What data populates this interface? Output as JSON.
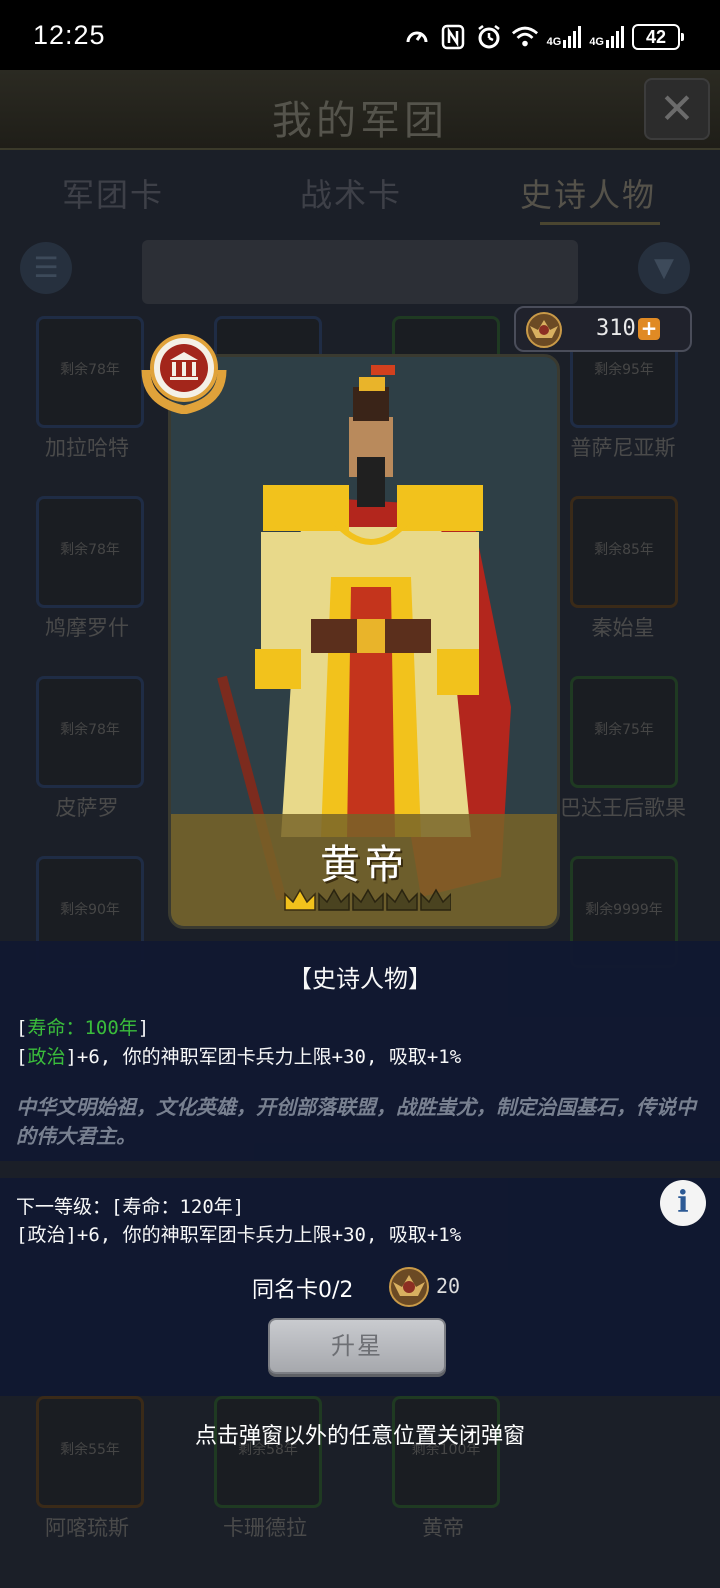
{
  "status_bar": {
    "time": "12:25",
    "network_1": "4G",
    "network_2": "4G",
    "battery": "42"
  },
  "background": {
    "title": "我的军团",
    "tabs": [
      "军团卡",
      "战术卡",
      "史诗人物"
    ],
    "active_tab": "史诗人物",
    "cards": [
      {
        "remaining": "剩余78年",
        "name": "加拉哈特"
      },
      {
        "remaining": "剩余95年",
        "name": "普萨尼亚斯"
      },
      {
        "remaining": "剩余78年",
        "name": "鸠摩罗什"
      },
      {
        "remaining": "剩余85年",
        "name": "秦始皇"
      },
      {
        "remaining": "剩余78年",
        "name": "皮萨罗"
      },
      {
        "remaining": "剩余75年",
        "name": "巴达王后歌果"
      },
      {
        "remaining": "剩余90年",
        "name": ""
      },
      {
        "remaining": "剩余9999年",
        "name": ""
      },
      {
        "remaining": "剩余55年",
        "name": "阿喀琉斯"
      },
      {
        "remaining": "剩余58年",
        "name": "卡珊德拉"
      },
      {
        "remaining": "剩余100年",
        "name": "黄帝"
      }
    ]
  },
  "currency": {
    "value": "310",
    "plus_icon": "+"
  },
  "hero": {
    "name": "黄帝",
    "stars_filled": 1,
    "stars_total": 5
  },
  "info": {
    "category": "【史诗人物】",
    "line1_open": "[",
    "line1_label": "寿命：100年",
    "line1_close": "]",
    "line2_open": "[",
    "line2_label": "政治",
    "line2_rest": "]+6, 你的神职军团卡兵力上限+30, 吸取+1%",
    "description": "中华文明始祖，文化英雄，开创部落联盟，战胜蚩尤，制定治国基石，传说中的伟大君主。"
  },
  "next_level": {
    "line1": "下一等级：[寿命：120年]",
    "line2": "[政治]+6, 你的神职军团卡兵力上限+30, 吸取+1%",
    "duplicate_label": "同名卡0/2",
    "cost": "20",
    "upgrade_button": "升星",
    "info_icon": "i"
  },
  "close_hint": "点击弹窗以外的任意位置关闭弹窗",
  "colors": {
    "panel": "#111831",
    "green_text": "#3cc23c",
    "desc_text": "#7c8494",
    "gold": "#f2c21c",
    "badge_red": "#a3261b"
  }
}
